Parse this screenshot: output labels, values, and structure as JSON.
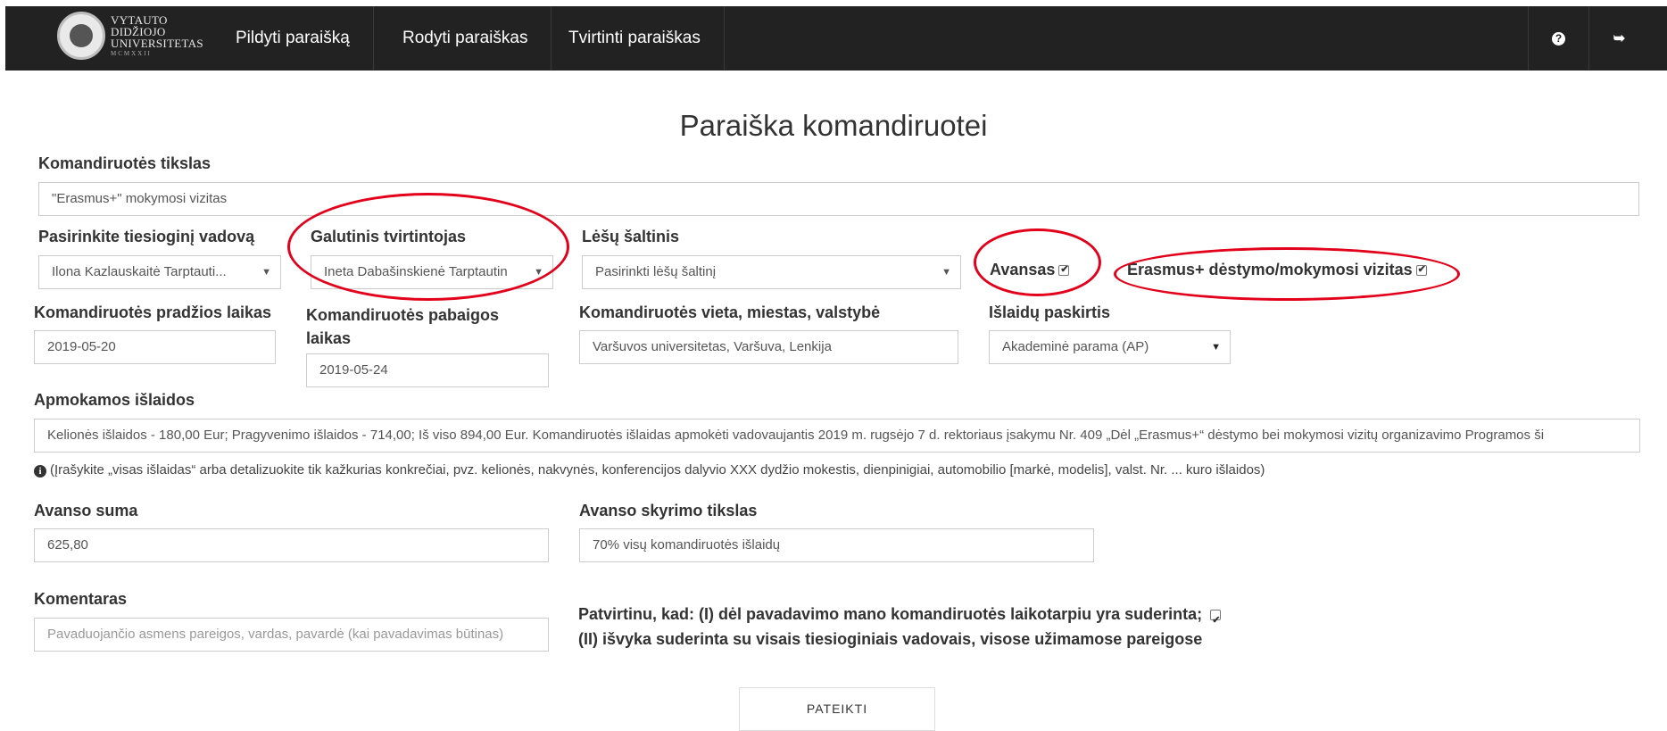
{
  "logo": {
    "line1": "VYTAUTO",
    "line2": "DIDŽIOJO",
    "line3": "UNIVERSITETAS",
    "line4": "MCMXXII"
  },
  "nav": {
    "items": [
      {
        "label": "Pildyti paraišką"
      },
      {
        "label": "Rodyti paraiškas"
      },
      {
        "label": "Tvirtinti paraiškas"
      }
    ],
    "help_icon": "question-circle-icon",
    "logout_icon": "sign-out-icon"
  },
  "form": {
    "title": "Paraiška komandiruotei",
    "purpose": {
      "label": "Komandiruotės tikslas",
      "value": "\"Erasmus+\" mokymosi vizitas"
    },
    "supervisor": {
      "label": "Pasirinkite tiesioginį vadovą",
      "value": "Ilona Kazlauskaitė Tarptauti..."
    },
    "approver": {
      "label": "Galutinis tvirtintojas",
      "value": "Ineta Dabašinskienė Tarptautin"
    },
    "funding": {
      "label": "Lėšų šaltinis",
      "value": "Pasirinkti lėšų šaltinį"
    },
    "advance_check": {
      "label": "Avansas",
      "checked": true
    },
    "erasmus_check": {
      "label": "Erasmus+ dėstymo/mokymosi vizitas",
      "checked": true
    },
    "start": {
      "label": "Komandiruotės pradžios laikas",
      "value": "2019-05-20"
    },
    "end": {
      "label_line1": "Komandiruotės pabaigos",
      "label_line2": "laikas",
      "value": "2019-05-24"
    },
    "place": {
      "label": "Komandiruotės vieta, miestas, valstybė",
      "value": "Varšuvos universitetas, Varšuva, Lenkija"
    },
    "cost_purpose": {
      "label": "Išlaidų paskirtis",
      "value": "Akademinė parama (AP)"
    },
    "expenses": {
      "label": "Apmokamos išlaidos",
      "value": "Kelionės išlaidos - 180,00 Eur; Pragyvenimo išlaidos - 714,00; Iš viso 894,00 Eur. Komandiruotės išlaidas apmokėti vadovaujantis 2019 m. rugsėjo 7 d. rektoriaus įsakymu Nr. 409 „Dėl „Erasmus+“ dėstymo bei mokymosi vizitų organizavimo Programos ši"
    },
    "hint": "(Įrašykite „visas išlaidas“ arba detalizuokite tik kažkurias konkrečiai, pvz. kelionės, nakvynės, konferencijos dalyvio XXX dydžio mokestis, dienpinigiai, automobilio [markė, modelis], valst. Nr. ... kuro išlaidos)",
    "advance_sum": {
      "label": "Avanso suma",
      "value": "625,80"
    },
    "advance_purpose": {
      "label": "Avanso skyrimo tikslas",
      "value": "70% visų komandiruotės išlaidų"
    },
    "comment": {
      "label": "Komentaras",
      "placeholder": "Pavaduojančio asmens pareigos, vardas, pavardė (kai pavadavimas būtinas)"
    },
    "confirm": {
      "line1": "Patvirtinu, kad: (I) dėl pavadavimo mano komandiruotės laikotarpiu yra suderinta;",
      "line2": "(II) išvyka suderinta su visais tiesioginiais vadovais, visose užimamose pareigose",
      "checked": true
    },
    "submit_label": "PATEIKTI"
  },
  "annotation_color": "#e2001a"
}
